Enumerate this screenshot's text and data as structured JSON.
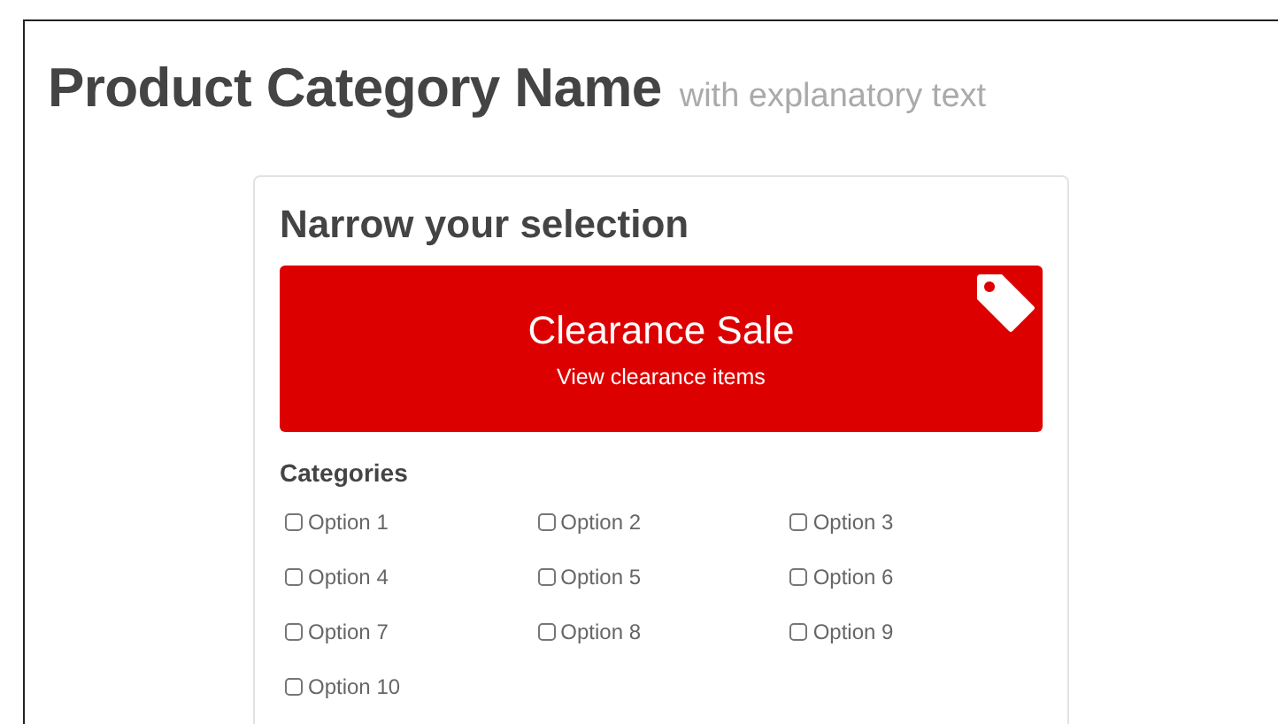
{
  "header": {
    "title": "Product Category Name",
    "subtitle": "with explanatory text"
  },
  "panel": {
    "title": "Narrow your selection",
    "promo": {
      "title": "Clearance Sale",
      "link": "View clearance items"
    },
    "categories": {
      "heading": "Categories",
      "options": [
        {
          "label": "Option 1",
          "checked": false
        },
        {
          "label": "Option 2",
          "checked": false
        },
        {
          "label": "Option 3",
          "checked": false
        },
        {
          "label": "Option 4",
          "checked": false
        },
        {
          "label": "Option 5",
          "checked": false
        },
        {
          "label": "Option 6",
          "checked": false
        },
        {
          "label": "Option 7",
          "checked": false
        },
        {
          "label": "Option 8",
          "checked": false
        },
        {
          "label": "Option 9",
          "checked": false
        },
        {
          "label": "Option 10",
          "checked": false
        }
      ]
    }
  }
}
